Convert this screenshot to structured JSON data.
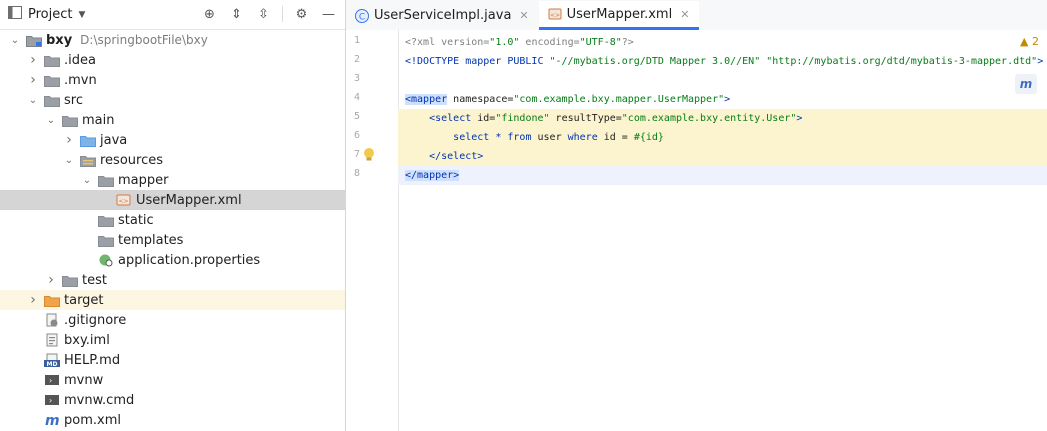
{
  "project_panel": {
    "title": "Project",
    "tree": [
      {
        "label": "bxy",
        "path": "D:\\springbootFile\\bxy",
        "icon": "module-folder-icon",
        "depth": 0,
        "arrow": "open"
      },
      {
        "label": ".idea",
        "icon": "folder-icon",
        "depth": 1,
        "arrow": "closed"
      },
      {
        "label": ".mvn",
        "icon": "folder-icon",
        "depth": 1,
        "arrow": "closed"
      },
      {
        "label": "src",
        "icon": "folder-icon",
        "depth": 1,
        "arrow": "open"
      },
      {
        "label": "main",
        "icon": "folder-icon",
        "depth": 2,
        "arrow": "open"
      },
      {
        "label": "java",
        "icon": "source-folder-icon",
        "depth": 3,
        "arrow": "closed"
      },
      {
        "label": "resources",
        "icon": "resources-folder-icon",
        "depth": 3,
        "arrow": "open"
      },
      {
        "label": "mapper",
        "icon": "folder-icon",
        "depth": 4,
        "arrow": "open"
      },
      {
        "label": "UserMapper.xml",
        "icon": "xml-file-icon",
        "depth": 5,
        "arrow": "none",
        "selected": true
      },
      {
        "label": "static",
        "icon": "folder-icon",
        "depth": 4,
        "arrow": "none"
      },
      {
        "label": "templates",
        "icon": "folder-icon",
        "depth": 4,
        "arrow": "none"
      },
      {
        "label": "application.properties",
        "icon": "properties-file-icon",
        "depth": 4,
        "arrow": "none"
      },
      {
        "label": "test",
        "icon": "folder-icon",
        "depth": 2,
        "arrow": "closed"
      },
      {
        "label": "target",
        "icon": "excluded-folder-icon",
        "depth": 1,
        "arrow": "closed",
        "excluded": true
      },
      {
        "label": ".gitignore",
        "icon": "gitignore-file-icon",
        "depth": 1,
        "arrow": "none"
      },
      {
        "label": "bxy.iml",
        "icon": "iml-file-icon",
        "depth": 1,
        "arrow": "none"
      },
      {
        "label": "HELP.md",
        "icon": "markdown-file-icon",
        "depth": 1,
        "arrow": "none"
      },
      {
        "label": "mvnw",
        "icon": "shell-file-icon",
        "depth": 1,
        "arrow": "none"
      },
      {
        "label": "mvnw.cmd",
        "icon": "cmd-file-icon",
        "depth": 1,
        "arrow": "none"
      },
      {
        "label": "pom.xml",
        "icon": "maven-file-icon",
        "depth": 1,
        "arrow": "none"
      }
    ]
  },
  "editor": {
    "tabs": [
      {
        "label": "UserServiceImpl.java",
        "icon": "java-class-icon",
        "active": false
      },
      {
        "label": "UserMapper.xml",
        "icon": "xml-file-icon",
        "active": true
      }
    ],
    "warning_count": "2",
    "line_numbers": [
      "1",
      "2",
      "3",
      "4",
      "5",
      "6",
      "7",
      "8"
    ],
    "lines": [
      "<?xml version=\"1.0\" encoding=\"UTF-8\"?>",
      "<!DOCTYPE mapper PUBLIC \"-//mybatis.org/DTD Mapper 3.0//EN\" \"http://mybatis.org/dtd/mybatis-3-mapper.dtd\">",
      "",
      "<mapper namespace=\"com.example.bxy.mapper.UserMapper\">",
      "    <select id=\"findone\" resultType=\"com.example.bxy.entity.User\">",
      "        select * from user where id = #{id}",
      "    </select>",
      "</mapper>"
    ],
    "colors": {
      "tag": "#0033b3",
      "string": "#067d17",
      "highlight": "#fcf4cf",
      "caret_line": "#edf2fc"
    }
  }
}
